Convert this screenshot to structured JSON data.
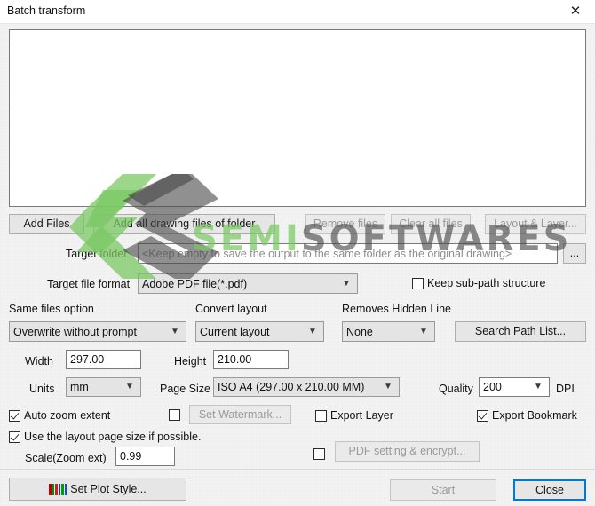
{
  "window": {
    "title": "Batch transform",
    "close_icon": "close-icon",
    "close_glyph": "✕"
  },
  "watermark": {
    "text_green": "SEMI",
    "text_dark": "SOFTWARES",
    "logo": "s-logo-watermark"
  },
  "file_list": {
    "items": [],
    "empty_text": ""
  },
  "file_buttons": {
    "add_files": "Add Files",
    "add_all_drawing_files": "Add all drawing files of folder",
    "remove_files": "Remove files",
    "clear_all_files": "Clear all files",
    "layout_and_layer": "Layout & Layer..."
  },
  "target_folder": {
    "label": "Target folder",
    "value": "",
    "placeholder": "<Keep empty to save the output to the same folder as the original drawing>",
    "browse_label": "..."
  },
  "target_file_format": {
    "label": "Target file format",
    "value": "Adobe PDF file(*.pdf)",
    "options": [
      "Adobe PDF file(*.pdf)"
    ]
  },
  "keep_sub_path": {
    "label": "Keep sub-path structure",
    "checked": false
  },
  "same_files_option": {
    "label": "Same files option",
    "value": "Overwrite without prompt",
    "options": [
      "Overwrite without prompt"
    ]
  },
  "convert_layout": {
    "label": "Convert layout",
    "value": "Current layout",
    "options": [
      "Current layout"
    ]
  },
  "removes_hidden_line": {
    "label": "Removes Hidden Line",
    "value": "None",
    "options": [
      "None"
    ]
  },
  "search_path_list": {
    "label": "Search Path List..."
  },
  "size": {
    "width_label": "Width",
    "width_value": "297.00",
    "height_label": "Height",
    "height_value": "210.00",
    "units_label": "Units",
    "units_value": "mm",
    "page_size_label": "Page Size",
    "page_size_value": "ISO A4 (297.00 x 210.00 MM)",
    "quality_label": "Quality",
    "quality_value": "200",
    "dpi_label": "DPI"
  },
  "options": {
    "auto_zoom_extent": {
      "label": "Auto zoom extent",
      "checked": true
    },
    "watermark_enable": {
      "label": "",
      "checked": false
    },
    "set_watermark_button": "Set Watermark...",
    "export_layer": {
      "label": "Export Layer",
      "checked": false
    },
    "export_bookmark": {
      "label": "Export Bookmark",
      "checked": true
    },
    "use_layout_page_size": {
      "label": "Use the layout page size if possible.",
      "checked": true
    },
    "scale_label": "Scale(Zoom ext)",
    "scale_value": "0.99",
    "pdf_setting_enable": {
      "label": "",
      "checked": false
    },
    "pdf_setting_button": "PDF setting & encrypt..."
  },
  "footer": {
    "set_plot_style": "Set Plot Style...",
    "start": "Start",
    "close": "Close"
  },
  "colors": {
    "accent": "#0078d7",
    "dialog_bg": "#f2f2f2",
    "button_bg": "#e6e6e6",
    "disabled_text": "#9a9a9a",
    "watermark_green": "#7ac864",
    "watermark_dark": "#464646"
  },
  "plot_icon_colors": [
    "#c00000",
    "#008f00",
    "#d02020",
    "#0040c0",
    "#00a000",
    "#1050d0"
  ]
}
